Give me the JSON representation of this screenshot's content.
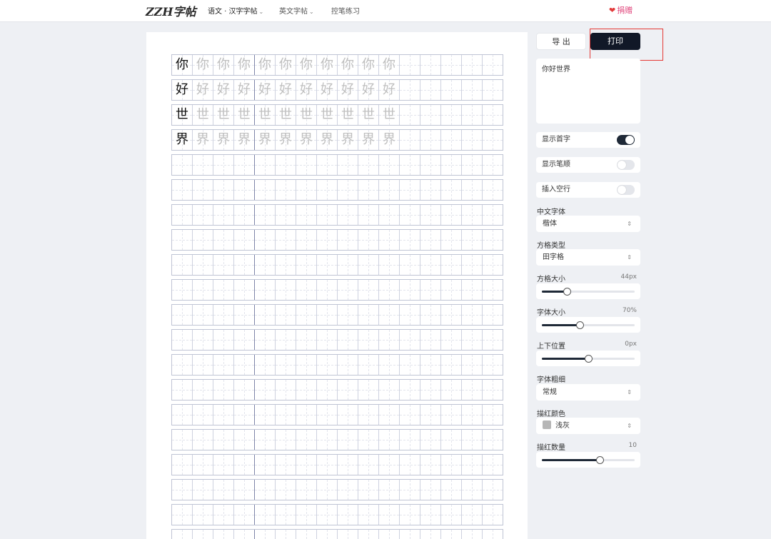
{
  "header": {
    "logo": "ZZH字帖",
    "nav": [
      {
        "label": "语文 · 汉字字帖",
        "has_dropdown": true
      },
      {
        "label": "英文字帖",
        "has_dropdown": true
      },
      {
        "label": "控笔练习",
        "has_dropdown": false
      }
    ],
    "donate_label": "捐赠"
  },
  "sheet": {
    "text": [
      "你",
      "好",
      "世",
      "界"
    ],
    "trace_count": 10,
    "total_rows": 20,
    "cells_per_row": 16
  },
  "actions": {
    "export_label": "导 出",
    "print_label": "打印"
  },
  "input": {
    "value": "你好世界"
  },
  "toggles": [
    {
      "label": "显示首字",
      "on": true
    },
    {
      "label": "显示笔顺",
      "on": false
    },
    {
      "label": "插入空行",
      "on": false
    }
  ],
  "chinese_font": {
    "label": "中文字体",
    "value": "楷体"
  },
  "grid_type": {
    "label": "方格类型",
    "value": "田字格"
  },
  "grid_size": {
    "label": "方格大小",
    "value_label": "44px",
    "fraction": 0.27
  },
  "font_size": {
    "label": "字体大小",
    "value_label": "70%",
    "fraction": 0.41
  },
  "vertical_pos": {
    "label": "上下位置",
    "value_label": "0px",
    "fraction": 0.5
  },
  "font_weight": {
    "label": "字体粗细",
    "value": "常规"
  },
  "trace_color": {
    "label": "描红颜色",
    "value": "浅灰",
    "color": "#b6b6b6"
  },
  "trace_amount": {
    "label": "描红数量",
    "value_label": "10",
    "fraction": 0.62
  }
}
